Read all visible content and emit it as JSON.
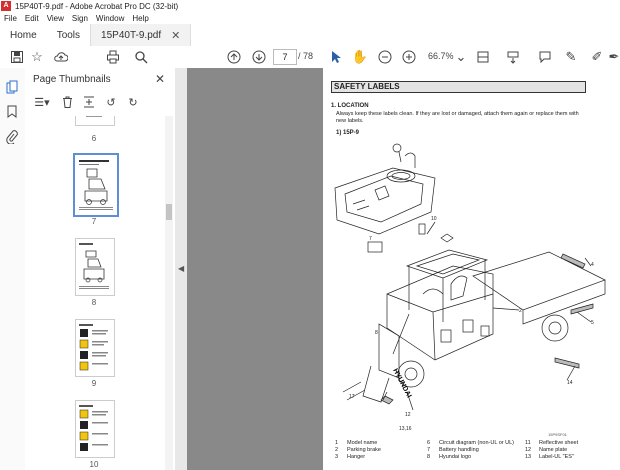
{
  "window": {
    "title": "15P40T-9.pdf - Adobe Acrobat Pro DC (32-bit)",
    "app_icon": "A"
  },
  "menu": [
    "File",
    "Edit",
    "View",
    "Sign",
    "Window",
    "Help"
  ],
  "tabs": {
    "home": "Home",
    "tools": "Tools",
    "doc": "15P40T-9.pdf"
  },
  "toolbar": {
    "page_current": "7",
    "page_total": "/ 78",
    "zoom": "66.7%"
  },
  "panel": {
    "title": "Page Thumbnails",
    "thumbnails": [
      {
        "label": "6"
      },
      {
        "label": "7",
        "active": true
      },
      {
        "label": "8"
      },
      {
        "label": "9"
      },
      {
        "label": "10"
      }
    ]
  },
  "document": {
    "section_title": "SAFETY LABELS",
    "location_heading": "1. LOCATION",
    "location_text": "Always keep these labels clean. If they are lost or damaged, attach them again or replace them with new labels.",
    "model_heading": "1) 15P-9",
    "figure_code": "15P9SF01",
    "callouts": [
      "1",
      "2",
      "3",
      "4",
      "5",
      "6",
      "7",
      "8",
      "9",
      "10",
      "11",
      "12",
      "13",
      "14",
      "13,16",
      "17"
    ],
    "legend": [
      {
        "n": "1",
        "label": "Model name"
      },
      {
        "n": "2",
        "label": "Parking brake"
      },
      {
        "n": "3",
        "label": "Hanger"
      },
      {
        "n": "6",
        "label": "Circuit diagram (non-UL or UL)"
      },
      {
        "n": "7",
        "label": "Battery handling"
      },
      {
        "n": "8",
        "label": "Hyundai logo"
      },
      {
        "n": "11",
        "label": "Reflective sheet"
      },
      {
        "n": "12",
        "label": "Name plate"
      },
      {
        "n": "13",
        "label": "Label-UL \"ES\""
      }
    ]
  }
}
